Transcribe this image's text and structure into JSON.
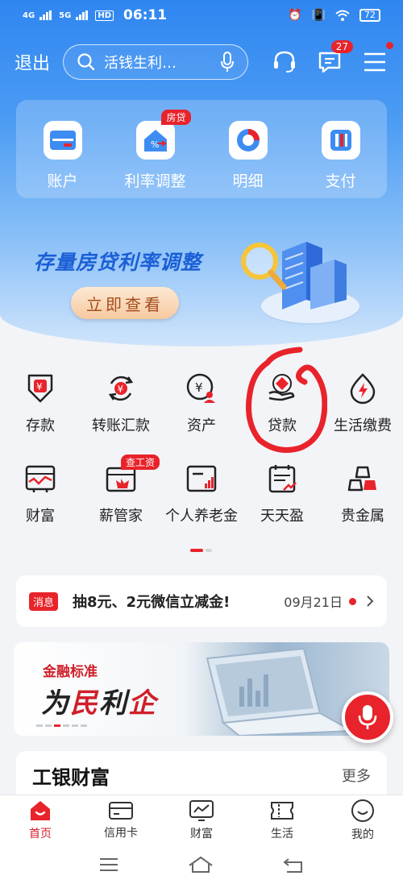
{
  "status_bar": {
    "network1": "4G",
    "network2": "5G",
    "hd": "HD",
    "time": "06:11",
    "battery": "72"
  },
  "header": {
    "exit_label": "退出",
    "search_placeholder": "活钱生利…",
    "message_badge": "27"
  },
  "quick_actions": [
    {
      "label": "账户",
      "icon": "account-card-icon"
    },
    {
      "label": "利率调整",
      "icon": "house-rate-icon",
      "tag": "房贷"
    },
    {
      "label": "明细",
      "icon": "pie-chart-icon"
    },
    {
      "label": "支付",
      "icon": "pay-icon"
    }
  ],
  "banner": {
    "title": "存量房贷利率调整",
    "button": "立即查看"
  },
  "service_grid": {
    "row1": [
      {
        "label": "存款",
        "icon": "deposit-icon"
      },
      {
        "label": "转账汇款",
        "icon": "transfer-icon"
      },
      {
        "label": "资产",
        "icon": "assets-icon"
      },
      {
        "label": "贷款",
        "icon": "loan-icon"
      },
      {
        "label": "生活缴费",
        "icon": "life-payment-icon"
      }
    ],
    "row2": [
      {
        "label": "财富",
        "icon": "wealth-icon"
      },
      {
        "label": "薪管家",
        "icon": "salary-icon",
        "tag": "查工资"
      },
      {
        "label": "个人养老金",
        "icon": "pension-icon"
      },
      {
        "label": "天天盈",
        "icon": "daily-profit-icon"
      },
      {
        "label": "贵金属",
        "icon": "precious-metal-icon"
      }
    ]
  },
  "message": {
    "tag": "消息",
    "text": "抽8元、2元微信立减金!",
    "date": "09月21日"
  },
  "ad_banner": {
    "line1": "金融标准",
    "line2_black1": "为",
    "line2_red1": "民",
    "line2_black2": "利",
    "line2_red2": "企"
  },
  "wealth_section": {
    "title": "工银财富",
    "more": "更多"
  },
  "tab_bar": [
    {
      "label": "首页",
      "active": true
    },
    {
      "label": "信用卡"
    },
    {
      "label": "财富"
    },
    {
      "label": "生活"
    },
    {
      "label": "我的"
    }
  ],
  "colors": {
    "brand_red": "#e8232b",
    "brand_blue": "#2f86f0"
  }
}
